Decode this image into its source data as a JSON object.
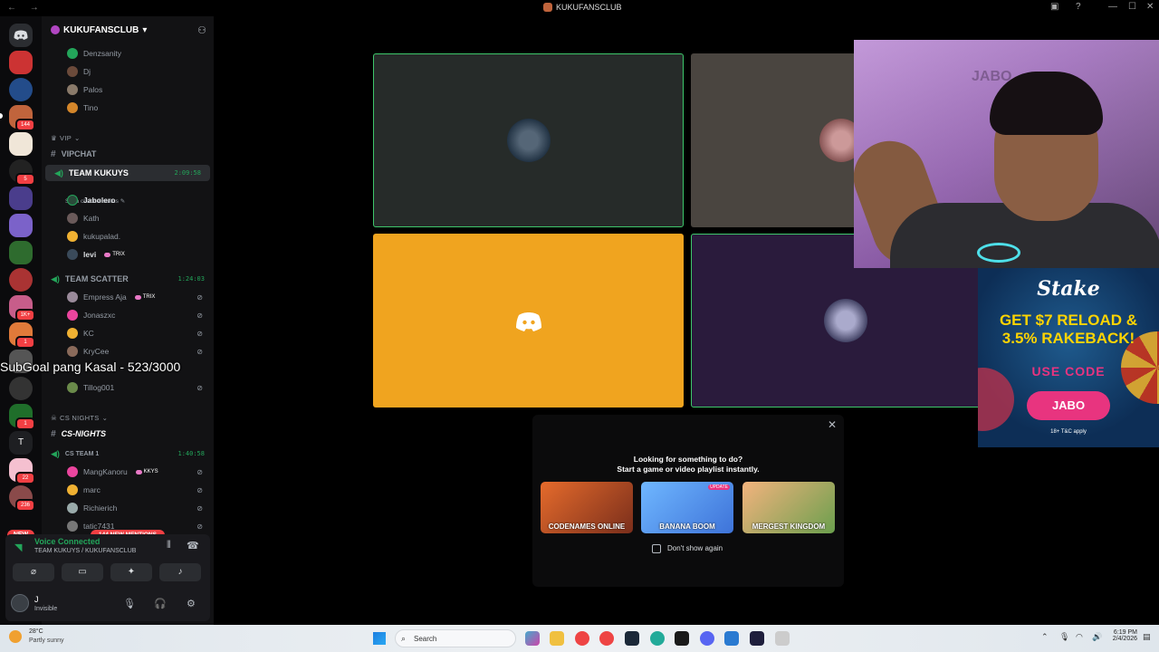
{
  "window": {
    "title": "KUKUFANSCLUB",
    "nav": "← →",
    "minimize": "—",
    "maximize": "☐",
    "close": "✕"
  },
  "guilds": {
    "badges": [
      "144",
      "5",
      "1K+",
      "1",
      "1",
      "22",
      "236"
    ],
    "letter_server": "T",
    "new_label": "NEW"
  },
  "server": {
    "name": "KUKUFANSCLUB",
    "chevron": "▾"
  },
  "channel_list": {
    "top_users": [
      "Denzsanity",
      "Dj",
      "Palos",
      "Tino"
    ],
    "vip_category": "VIP",
    "vipchat": "VIPCHAT",
    "team_kukuys": {
      "name": "TEAM KUKUYS",
      "time": "2:09:58",
      "status": "Set a channel status ✎",
      "users": [
        "Jabolero",
        "Kath",
        "kukupalad.",
        "levi"
      ],
      "levi_tag": "TRIX"
    },
    "team_scatter": {
      "name": "TEAM SCATTER",
      "time": "1:24:03",
      "users": [
        "Empress Aja",
        "Jonaszxc",
        "KC",
        "KryCee",
        "Tillog001"
      ],
      "empress_tag": "TRIX"
    },
    "cs_category": "CS NIGHTS",
    "cs_nights": "CS-NIGHTS",
    "cs_team": {
      "name": "CS TEAM 1",
      "time": "1:40:58",
      "users": [
        "MangKanoru",
        "marc",
        "Richierich",
        "tatic7431"
      ],
      "mang_tag": "KKYS"
    },
    "mentions": "144 NEW MENTIONS"
  },
  "voice_panel": {
    "status": "Voice Connected",
    "location": "TEAM KUKUYS / KUKUFANSCLUB",
    "user": "J",
    "user_status": "Invisible"
  },
  "overlay": {
    "subgoal": "SubGoal pang Kasal - 523/3000"
  },
  "ad": {
    "brand": "Stake",
    "headline_1": "GET $7 RELOAD &",
    "headline_2": "3.5% RAKEBACK!",
    "use_code": "USE CODE",
    "code": "JABO",
    "tc": "18+ T&C apply"
  },
  "activity": {
    "line1": "Looking for something to do?",
    "line2": "Start a game or video playlist instantly.",
    "games": [
      "CODENAMES ONLINE",
      "BANANA BOOM",
      "MERGEST KINGDOM"
    ],
    "update_badge": "UPDATE",
    "dont_show": "Don't show again"
  },
  "taskbar": {
    "temp": "28°C",
    "weather": "Partly sunny",
    "search": "Search",
    "time": "6:19 PM",
    "date": "2/4/2026"
  },
  "colors": {
    "accent_green": "#23a55a",
    "mention_red": "#f23f43",
    "blurple": "#5865f2"
  }
}
